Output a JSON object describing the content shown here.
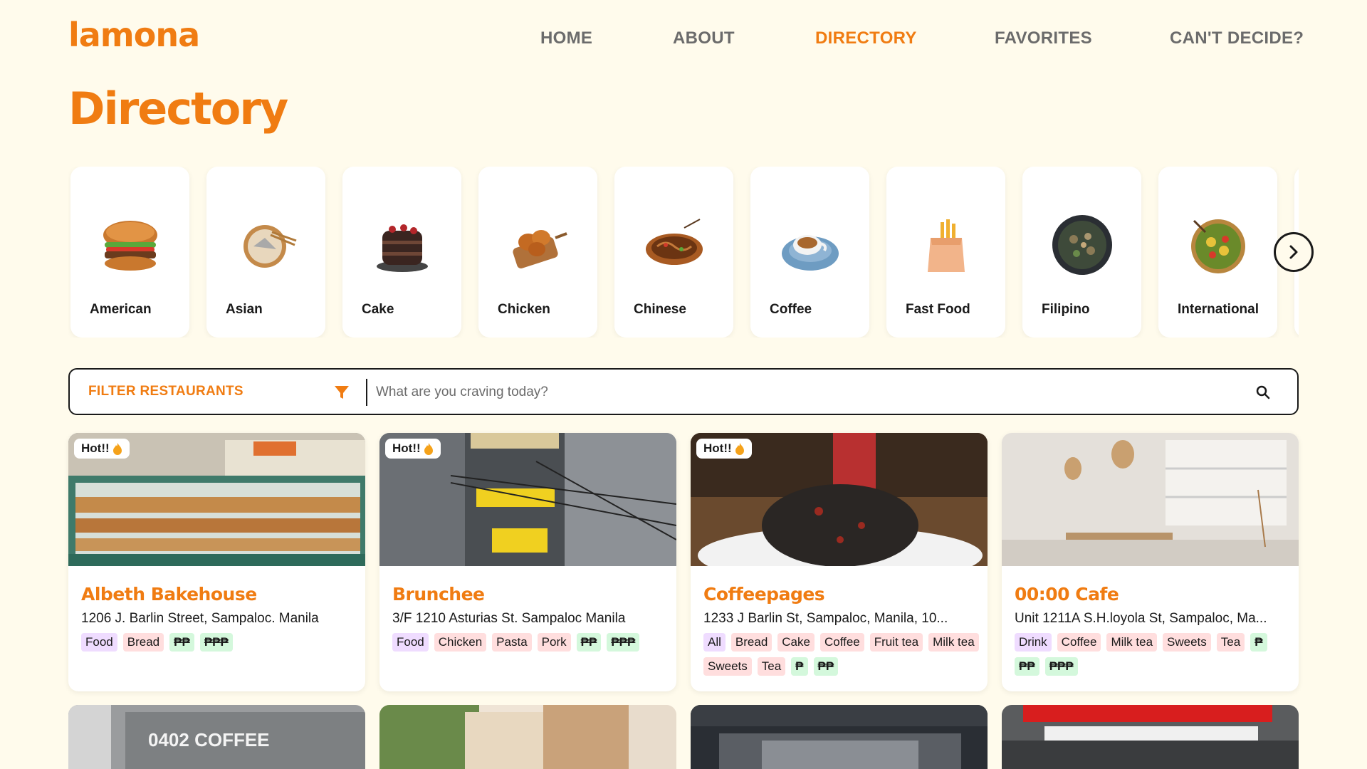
{
  "app": {
    "logo": "lamona"
  },
  "nav": {
    "items": [
      {
        "label": "HOME",
        "active": false
      },
      {
        "label": "ABOUT",
        "active": false
      },
      {
        "label": "DIRECTORY",
        "active": true
      },
      {
        "label": "FAVORITES",
        "active": false
      },
      {
        "label": "CAN'T DECIDE?",
        "active": false
      }
    ]
  },
  "page": {
    "title": "Directory"
  },
  "categories": [
    {
      "label": "American",
      "icon": "burger-icon"
    },
    {
      "label": "Asian",
      "icon": "dumpling-bowl-icon"
    },
    {
      "label": "Cake",
      "icon": "cake-icon"
    },
    {
      "label": "Chicken",
      "icon": "fried-chicken-icon"
    },
    {
      "label": "Chinese",
      "icon": "noodles-icon"
    },
    {
      "label": "Coffee",
      "icon": "coffee-cup-icon"
    },
    {
      "label": "Fast Food",
      "icon": "fries-bag-icon"
    },
    {
      "label": "Filipino",
      "icon": "filipino-dish-icon"
    },
    {
      "label": "International",
      "icon": "salad-bowl-icon"
    }
  ],
  "filter": {
    "label": "FILTER RESTAURANTS",
    "search_placeholder": "What are you craving today?"
  },
  "badge": {
    "hot": "Hot!!"
  },
  "restaurants": [
    {
      "name": "Albeth Bakehouse",
      "address": "1206 J. Barlin Street, Sampaloc. Manila",
      "hot": true,
      "tags": [
        {
          "text": "Food",
          "kind": "purple"
        },
        {
          "text": "Bread",
          "kind": "pink"
        },
        {
          "text": "₱₱",
          "kind": "green"
        },
        {
          "text": "₱₱₱",
          "kind": "green"
        }
      ]
    },
    {
      "name": "Brunchee",
      "address": "3/F 1210 Asturias St. Sampaloc Manila",
      "hot": true,
      "tags": [
        {
          "text": "Food",
          "kind": "purple"
        },
        {
          "text": "Chicken",
          "kind": "pink"
        },
        {
          "text": "Pasta",
          "kind": "pink"
        },
        {
          "text": "Pork",
          "kind": "pink"
        },
        {
          "text": "₱₱",
          "kind": "green"
        },
        {
          "text": "₱₱₱",
          "kind": "green"
        }
      ]
    },
    {
      "name": "Coffeepages",
      "address": "1233 J Barlin St, Sampaloc, Manila, 10...",
      "hot": true,
      "tags": [
        {
          "text": "All",
          "kind": "purple"
        },
        {
          "text": "Bread",
          "kind": "pink"
        },
        {
          "text": "Cake",
          "kind": "pink"
        },
        {
          "text": "Coffee",
          "kind": "pink"
        },
        {
          "text": "Fruit tea",
          "kind": "pink"
        },
        {
          "text": "Milk tea",
          "kind": "pink"
        },
        {
          "text": "Sweets",
          "kind": "pink"
        },
        {
          "text": "Tea",
          "kind": "pink"
        },
        {
          "text": "₱",
          "kind": "green"
        },
        {
          "text": "₱₱",
          "kind": "green"
        }
      ]
    },
    {
      "name": "00:00 Cafe",
      "address": "Unit 1211A S.H.loyola St, Sampaloc, Ma...",
      "hot": false,
      "tags": [
        {
          "text": "Drink",
          "kind": "purple"
        },
        {
          "text": "Coffee",
          "kind": "pink"
        },
        {
          "text": "Milk tea",
          "kind": "pink"
        },
        {
          "text": "Sweets",
          "kind": "pink"
        },
        {
          "text": "Tea",
          "kind": "pink"
        },
        {
          "text": "₱",
          "kind": "green"
        },
        {
          "text": "₱₱",
          "kind": "green"
        },
        {
          "text": "₱₱₱",
          "kind": "green"
        }
      ]
    }
  ],
  "second_row": [
    {
      "sign_text": "0402 COFFEE"
    },
    {
      "sign_text": ""
    },
    {
      "sign_text": ""
    },
    {
      "sign_text": ""
    }
  ],
  "colors": {
    "accent": "#f07c12",
    "background": "#fffbec",
    "tag_purple": "#efdcff",
    "tag_pink": "#ffdede",
    "tag_green": "#d4f8dc"
  }
}
